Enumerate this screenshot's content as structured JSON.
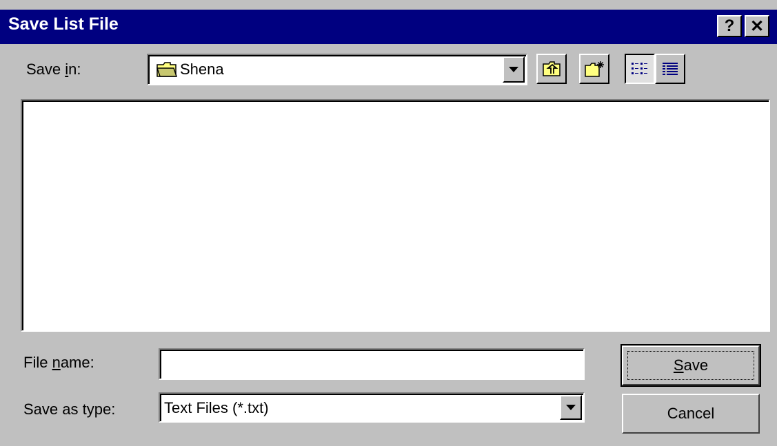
{
  "window": {
    "title": "Save List File",
    "help_label": "?",
    "close_label": "✕"
  },
  "save_in": {
    "label_pre": "Save ",
    "label_accel": "i",
    "label_post": "n:",
    "value": "Shena",
    "icon": "folder-icon"
  },
  "toolbar": {
    "buttons": [
      {
        "name": "up-one-level-icon"
      },
      {
        "name": "create-new-folder-icon"
      },
      {
        "name": "list-view-icon",
        "pressed": true
      },
      {
        "name": "details-view-icon"
      }
    ]
  },
  "file_name": {
    "label_pre": "File ",
    "label_accel": "n",
    "label_post": "ame:",
    "value": ""
  },
  "save_as_type": {
    "label": "Save as type:",
    "value": "Text Files (*.txt)"
  },
  "buttons": {
    "save_accel": "S",
    "save_rest": "ave",
    "cancel": "Cancel"
  },
  "colors": {
    "titlebar": "#000080",
    "face": "#c0c0c0",
    "folder": "#ffff80"
  }
}
